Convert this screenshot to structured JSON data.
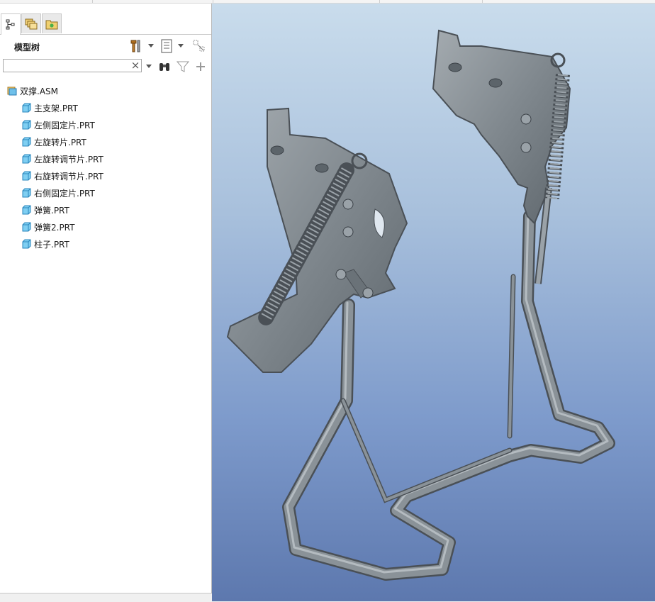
{
  "panel": {
    "title": "模型树",
    "search": {
      "value": "",
      "placeholder": ""
    },
    "clear_symbol": "×",
    "tabs": [
      {
        "name": "model-tree-tab",
        "icon": "tree-icon",
        "active": true
      },
      {
        "name": "layers-tab",
        "icon": "layers-icon",
        "active": false
      },
      {
        "name": "favorites-tab",
        "icon": "favorites-folder-icon",
        "active": false
      }
    ],
    "toolbar_icons": [
      "settings-tools-icon",
      "show-list-icon",
      "display-toggle-icon",
      "find-binoculars-icon",
      "filter-icon",
      "add-icon"
    ]
  },
  "tree": {
    "root": {
      "label": "双撑.ASM",
      "icon": "assembly-icon"
    },
    "items": [
      {
        "label": "主支架.PRT",
        "icon": "part-icon"
      },
      {
        "label": "左侧固定片.PRT",
        "icon": "part-icon"
      },
      {
        "label": "左旋转片.PRT",
        "icon": "part-icon"
      },
      {
        "label": "左旋转调节片.PRT",
        "icon": "part-icon"
      },
      {
        "label": "右旋转调节片.PRT",
        "icon": "part-icon"
      },
      {
        "label": "右侧固定片.PRT",
        "icon": "part-icon"
      },
      {
        "label": "弹簧.PRT",
        "icon": "part-icon"
      },
      {
        "label": "弹簧2.PRT",
        "icon": "part-icon"
      },
      {
        "label": "柱子.PRT",
        "icon": "part-icon"
      }
    ]
  },
  "colors": {
    "viewport_top": "#c9dcec",
    "viewport_bottom": "#5d78ae",
    "model_metal": "#7f878d",
    "model_edge": "#4a5056",
    "part_icon": "#4fb0e0",
    "assembly_icon": "#e8b040"
  }
}
